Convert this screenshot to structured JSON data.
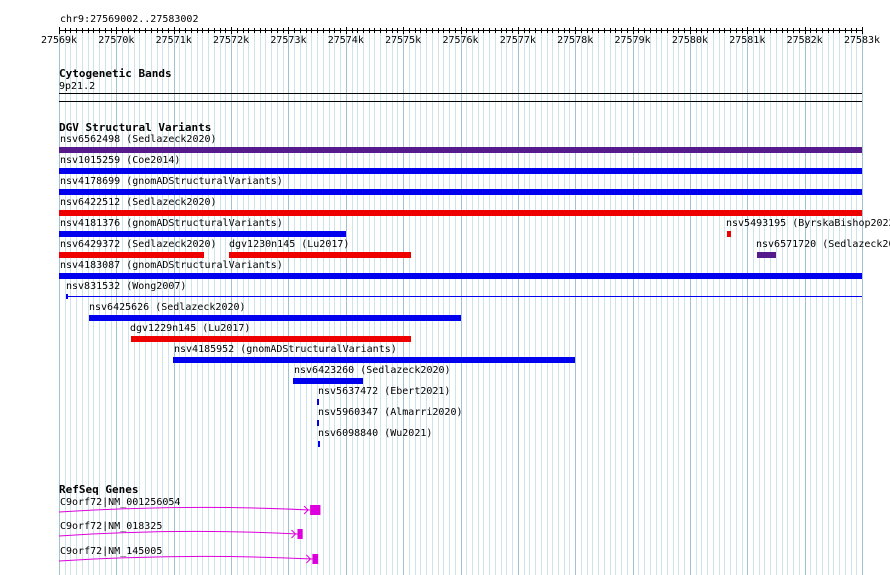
{
  "region_label": "chr9:27569002..27583002",
  "ruler": {
    "start": 27569002,
    "end": 27583002,
    "tick_labels": [
      "27569k",
      "27570k",
      "27571k",
      "27572k",
      "27573k",
      "27574k",
      "27575k",
      "27576k",
      "27577k",
      "27578k",
      "27579k",
      "27580k",
      "27581k",
      "27582k",
      "27583k"
    ]
  },
  "cytobands": {
    "title": "Cytogenetic Bands",
    "band": "9p21.2"
  },
  "dgv": {
    "title": "DGV Structural Variants",
    "variants": [
      {
        "label": "nsv6562498 (Sedlazeck2020)",
        "start": 27569002,
        "end": 27583002,
        "color": "#551a8b"
      },
      {
        "label": "nsv1015259 (Coe2014)",
        "start": 27569002,
        "end": 27583002,
        "color": "#0000ee"
      },
      {
        "label": "nsv4178699 (gnomADStructuralVariants)",
        "start": 27569002,
        "end": 27583002,
        "color": "#0000ee"
      },
      {
        "label": "nsv6422512 (Sedlazeck2020)",
        "start": 27569002,
        "end": 27583002,
        "color": "#ee0000"
      },
      {
        "label": "nsv4181376 (gnomADStructuralVariants)",
        "start": 27569002,
        "end": 27574010,
        "color": "#0000ee"
      },
      {
        "label": "nsv5493195 (ByrskaBishop2022)",
        "start": 27580640,
        "end": 27580720,
        "color": "#ee0000"
      },
      {
        "label": "nsv6429372 (Sedlazeck2020)",
        "start": 27569002,
        "end": 27571530,
        "color": "#ee0000"
      },
      {
        "label": "dgv1230n145 (Lu2017)",
        "start": 27571970,
        "end": 27575140,
        "color": "#ee0000"
      },
      {
        "label": "nsv6571720 (Sedlazeck2020)",
        "start": 27581180,
        "end": 27581510,
        "color": "#551a8b"
      },
      {
        "label": "nsv4183087 (gnomADStructuralVariants)",
        "start": 27569002,
        "end": 27583002,
        "color": "#0000ee"
      },
      {
        "label": "nsv831532 (Wong2007)",
        "start": 27569130,
        "end": 27583002,
        "color": "#0000ee"
      },
      {
        "label": "nsv6425626 (Sedlazeck2020)",
        "start": 27569520,
        "end": 27576010,
        "color": "#0000ee"
      },
      {
        "label": "dgv1229n145 (Lu2017)",
        "start": 27570260,
        "end": 27575140,
        "color": "#ee0000"
      },
      {
        "label": "nsv4185952 (gnomADStructuralVariants)",
        "start": 27570990,
        "end": 27578000,
        "color": "#0000ee"
      },
      {
        "label": "nsv6423260 (Sedlazeck2020)",
        "start": 27573090,
        "end": 27574300,
        "color": "#0000ee"
      },
      {
        "label": "nsv5637472 (Ebert2021)",
        "start": 27573500,
        "end": 27573535,
        "color": "#0000ee"
      },
      {
        "label": "nsv5960347 (Almarri2020)",
        "start": 27573500,
        "end": 27573535,
        "color": "#0000ee"
      },
      {
        "label": "nsv6098840 (Wu2021)",
        "start": 27573520,
        "end": 27573555,
        "color": "#0000ee"
      }
    ]
  },
  "refseq": {
    "title": "RefSeq Genes",
    "genes": [
      {
        "label": "C9orf72|NM_001256054",
        "start": 27569002,
        "end": 27573560,
        "exon_start": 27573380,
        "exon_end": 27573560
      },
      {
        "label": "C9orf72|NM_018325",
        "start": 27569002,
        "end": 27573250,
        "exon_start": 27573160,
        "exon_end": 27573250
      },
      {
        "label": "C9orf72|NM_145005",
        "start": 27569002,
        "end": 27573520,
        "exon_start": 27573420,
        "exon_end": 27573520
      }
    ],
    "gene_color": "#dd00dd"
  }
}
